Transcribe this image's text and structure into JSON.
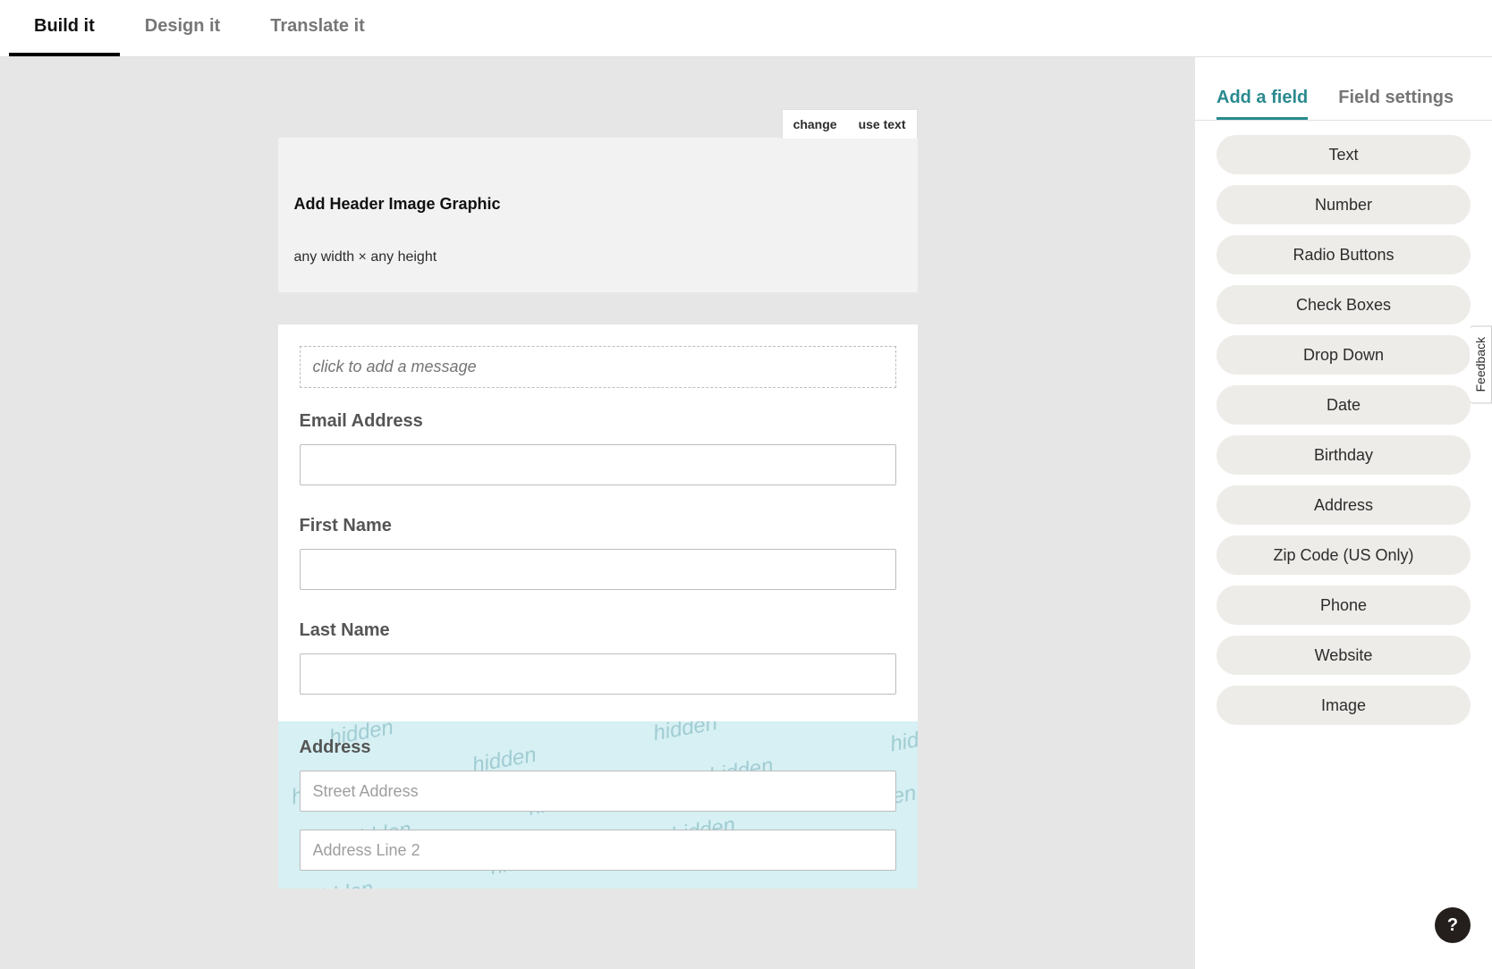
{
  "top_tabs": {
    "build": "Build it",
    "design": "Design it",
    "translate": "Translate it"
  },
  "header_block": {
    "change_label": "change",
    "use_text_label": "use text",
    "title": "Add Header Image Graphic",
    "subtitle": "any width × any height"
  },
  "form": {
    "message_placeholder": "click to add a message",
    "fields": {
      "email_label": "Email Address",
      "first_name_label": "First Name",
      "last_name_label": "Last Name",
      "address_label": "Address",
      "street_placeholder": "Street Address",
      "line2_placeholder": "Address Line 2"
    },
    "hidden_watermark": "hidden"
  },
  "sidebar": {
    "add_field_label": "Add a field",
    "field_settings_label": "Field settings",
    "field_types": {
      "text": "Text",
      "number": "Number",
      "radio": "Radio Buttons",
      "checkbox": "Check Boxes",
      "dropdown": "Drop Down",
      "date": "Date",
      "birthday": "Birthday",
      "address": "Address",
      "zip": "Zip Code (US Only)",
      "phone": "Phone",
      "website": "Website",
      "image": "Image"
    }
  },
  "feedback_label": "Feedback",
  "help_label": "?"
}
